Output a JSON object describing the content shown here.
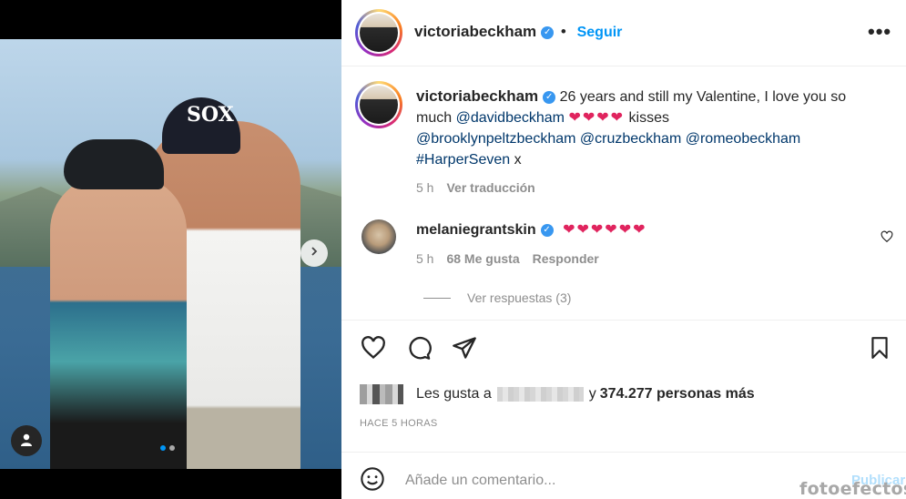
{
  "post": {
    "carousel": {
      "slides": 2,
      "active_slide": 1
    },
    "photo_text": "SOX"
  },
  "header": {
    "username": "victoriabeckham",
    "follow_label": "Seguir",
    "more_label": "•••"
  },
  "caption": {
    "username": "victoriabeckham",
    "text_1": "26 years and still my Valentine, I love you so much",
    "mention_1": "@davidbeckham",
    "hearts": "❤❤❤❤",
    "text_2": "kisses",
    "mention_2": "@brooklynpeltzbeckham",
    "mention_3": "@cruzbeckham",
    "mention_4": "@romeobeckham",
    "hashtag": "#HarperSeven",
    "text_3": "x",
    "time": "5 h",
    "translate_label": "Ver traducción"
  },
  "comment": {
    "username": "melaniegrantskin",
    "hearts": "❤❤❤❤❤❤",
    "time": "5 h",
    "likes": "68 Me gusta",
    "reply_label": "Responder",
    "view_replies": "Ver respuestas (3)"
  },
  "likes": {
    "prefix": "Les gusta a",
    "suffix": "y",
    "count": "374.277 personas más"
  },
  "time_ago": "HACE 5 HORAS",
  "add_comment": {
    "placeholder": "Añade un comentario...",
    "post_label": "Publicar"
  },
  "watermark": "fotoefectos",
  "colors": {
    "accent": "#0095f6",
    "verified": "#3897f0",
    "mention": "#00376b",
    "heart": "#e0245e",
    "muted": "#8e8e8e",
    "text": "#262626"
  },
  "icons": [
    "heart-icon",
    "comment-icon",
    "share-icon",
    "bookmark-icon",
    "emoji-icon",
    "user-tag-icon",
    "chevron-right-icon",
    "verified-icon",
    "more-icon"
  ]
}
